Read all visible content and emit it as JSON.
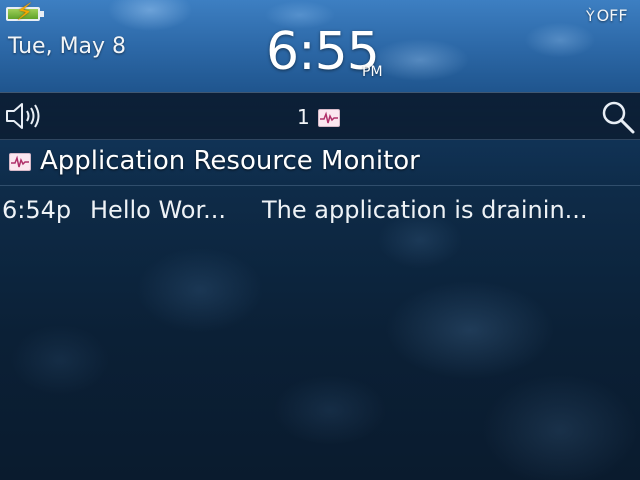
{
  "status_bar": {
    "date": "Tue, May 8",
    "time": "6:55",
    "ampm": "PM",
    "radio": "OFF",
    "battery": {
      "charging": true
    }
  },
  "notification_bar": {
    "count": "1",
    "icons": [
      "speaker-icon",
      "app-resource-monitor-icon",
      "search-icon"
    ]
  },
  "message_list": {
    "group_title": "Application Resource Monitor",
    "items": [
      {
        "time": "6:54p",
        "sender": "Hello Wor...",
        "preview": "The application is drainin..."
      }
    ]
  },
  "colors": {
    "banner": "#2d69a8",
    "background": "#0c1e33",
    "battery_fill": "#7fbf3f",
    "bolt": "#f6a800",
    "text": "#ffffff"
  }
}
